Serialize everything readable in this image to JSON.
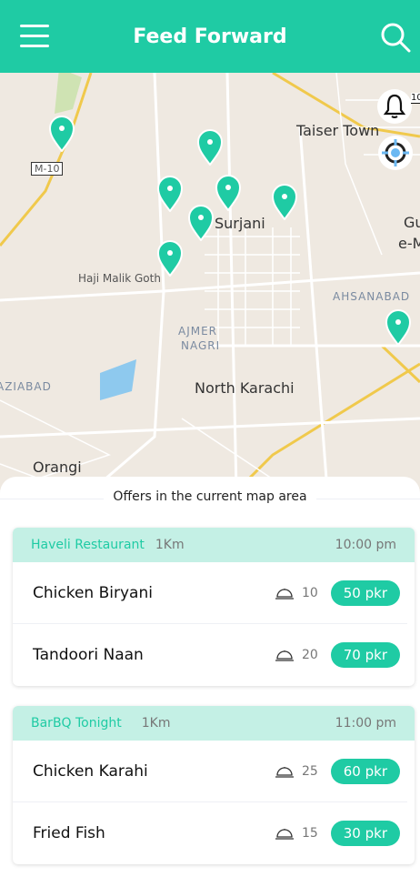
{
  "header": {
    "title": "Feed Forward",
    "menu_icon": "hamburger-icon",
    "search_icon": "search-icon",
    "color": "#1fcba4"
  },
  "map": {
    "labels": {
      "m10": "M-10",
      "taiser": "Taiser Town",
      "surjani": "Surjani",
      "gu": "Gu",
      "em": "e-M",
      "haji": "Haji Malik Goth",
      "ahsanabad": "AHSANABAD",
      "ajmer1": "AJMER",
      "ajmer2": "NAGRI",
      "north": "North Karachi",
      "aziabad": "AZIABAD",
      "orangi": "Orangi"
    },
    "notification_badge": "10"
  },
  "offers": {
    "title": "Offers in the current map area",
    "restaurants": [
      {
        "name": "Haveli Restaurant",
        "distance": "1Km",
        "time": "10:00 pm",
        "items": [
          {
            "dish": "Chicken Biryani",
            "count": "10",
            "price": "50 pkr"
          },
          {
            "dish": "Tandoori Naan",
            "count": "20",
            "price": "70 pkr"
          }
        ]
      },
      {
        "name": "BarBQ Tonight",
        "distance": "1Km",
        "time": "11:00 pm",
        "items": [
          {
            "dish": "Chicken Karahi",
            "count": "25",
            "price": "60 pkr"
          },
          {
            "dish": "Fried Fish",
            "count": "15",
            "price": "30 pkr"
          }
        ]
      }
    ]
  }
}
